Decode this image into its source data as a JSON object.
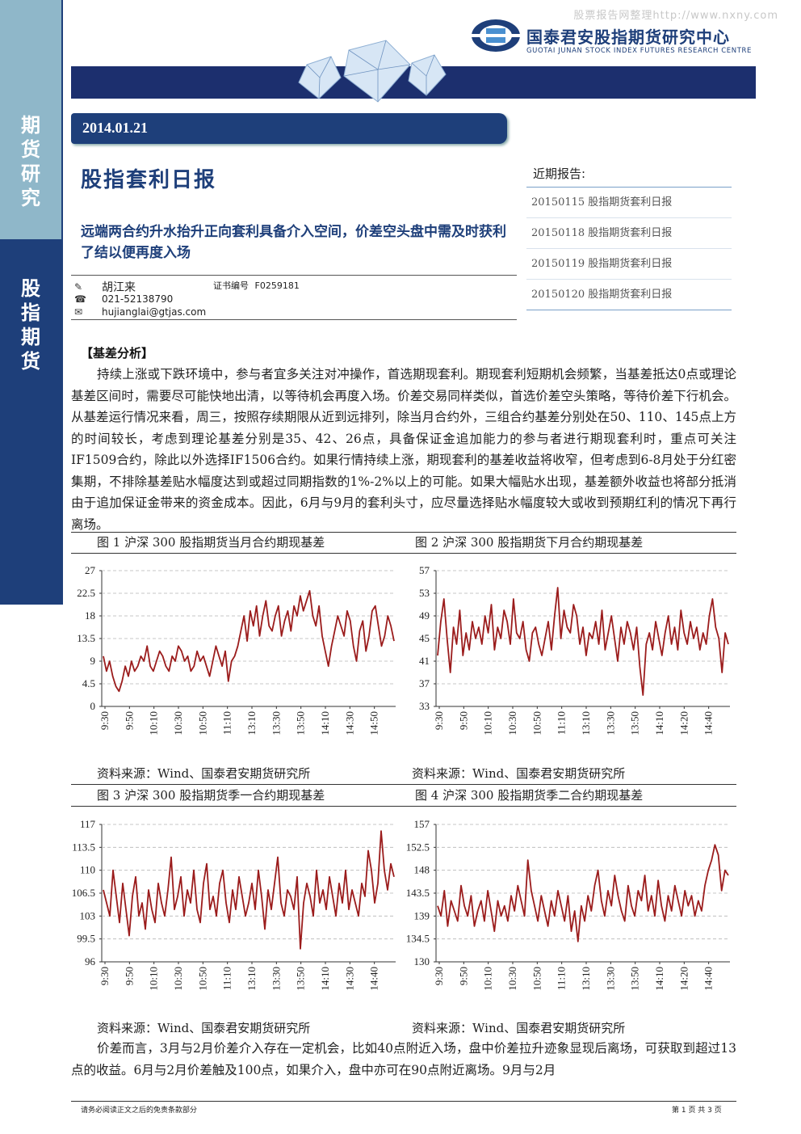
{
  "watermark": "股票报告网整理http://www.nxny.com",
  "sidebar": {
    "top_label": "期货研究",
    "bottom_label": "股指期货"
  },
  "logo": {
    "name_cn": "国泰君安股指期货研究中心",
    "name_en": "GUOTAI JUNAN STOCK INDEX FUTURES RESEARCH CENTRE"
  },
  "date": "2014.01.21",
  "title": "股指套利日报",
  "headline": "远端两合约升水抬升正向套利具备介入空间，价差空头盘中需及时获利了结以便再度入场",
  "author": {
    "name": "胡江来",
    "cert_label": "证书编号",
    "cert_no": "F0259181",
    "phone": "021-52138790",
    "email": "hujianglai@gtjas.com"
  },
  "recent": {
    "title": "近期报告:",
    "items": [
      "20150115 股指期货套利日报",
      "20150118 股指期货套利日报",
      "20150119 股指期货套利日报",
      "20150120 股指期货套利日报"
    ]
  },
  "section_title": "【基差分析】",
  "paragraph1": "持续上涨或下跌环境中，参与者宜多关注对冲操作，首选期现套利。期现套利短期机会频繁，当基差抵达0点或理论基差区间时，需要尽可能快地出清，以等待机会再度入场。价差交易同样类似，首选价差空头策略，等待价差下行机会。从基差运行情况来看，周三，按照存续期限从近到远排列，除当月合约外，三组合约基差分别处在50、110、145点上方的时间较长，考虑到理论基差分别是35、42、26点，具备保证金追加能力的参与者进行期现套利时，重点可关注IF1509合约，除此以外选择IF1506合约。如果行情持续上涨，期现套利的基差收益将收窄，但考虑到6-8月处于分红密集期，不排除基差贴水幅度达到或超过同期指数的1%-2%以上的可能。如果大幅贴水出现，基差额外收益也将部分抵消由于追加保证金带来的资金成本。因此，6月与9月的套利头寸，应尽量选择贴水幅度较大或收到预期红利的情况下再行离场。",
  "paragraph2": "价差而言，3月与2月价差介入存在一定机会，比如40点附近入场，盘中价差拉升迹象显现后离场，可获取到超过13点的收益。6月与2月价差触及100点，如果介入，盘中亦可在90点附近离场。9月与2月",
  "source_text": "资料来源：Wind、国泰君安期货研究所",
  "footer": {
    "left": "请务必阅读正文之后的免责条款部分",
    "right": "第 1 页 共 3 页"
  },
  "colors": {
    "navy": "#1e3f7a",
    "line": "#9b1c1c"
  },
  "chart_data": [
    {
      "type": "line",
      "caption": "图 1 沪深 300 股指期货当月合约期现基差",
      "x_ticks": [
        "9:30",
        "9:50",
        "10:10",
        "10:30",
        "10:50",
        "11:10",
        "13:10",
        "13:30",
        "13:50",
        "14:10",
        "14:30",
        "14:50"
      ],
      "y_ticks": [
        "27",
        "22.5",
        "18",
        "13.5",
        "9",
        "4.5",
        "0"
      ],
      "ylim": [
        0,
        27
      ],
      "values": [
        10,
        7,
        9,
        6,
        4,
        3,
        5,
        8,
        6,
        9,
        7,
        8,
        10,
        9,
        12,
        8,
        7,
        9,
        11,
        10,
        8,
        7,
        10,
        9,
        12,
        11,
        9,
        10,
        7,
        8,
        11,
        9,
        10,
        8,
        6,
        9,
        12,
        10,
        8,
        11,
        5,
        9,
        10,
        12,
        15,
        18,
        13,
        19,
        16,
        20,
        14,
        18,
        21,
        16,
        15,
        18,
        20,
        14,
        17,
        19,
        15,
        20,
        18,
        22,
        19,
        21,
        23,
        18,
        16,
        20,
        14,
        11,
        8,
        12,
        15,
        18,
        16,
        14,
        19,
        17,
        12,
        9,
        15,
        17,
        11,
        14,
        19,
        20,
        16,
        12,
        14,
        18,
        16,
        13
      ]
    },
    {
      "type": "line",
      "caption": "图 2 沪深 300 股指期货下月合约期现基差",
      "x_ticks": [
        "9:30",
        "9:50",
        "10:10",
        "10:30",
        "10:50",
        "11:10",
        "13:10",
        "13:30",
        "13:50",
        "14:10",
        "14:20",
        "14:40"
      ],
      "y_ticks": [
        "57",
        "53",
        "49",
        "45",
        "41",
        "37",
        "33"
      ],
      "ylim": [
        33,
        57
      ],
      "values": [
        42,
        48,
        52,
        45,
        39,
        47,
        44,
        50,
        42,
        46,
        43,
        48,
        45,
        47,
        44,
        49,
        46,
        51,
        43,
        47,
        45,
        50,
        48,
        44,
        52,
        46,
        45,
        48,
        43,
        41,
        46,
        47,
        44,
        42,
        45,
        48,
        43,
        49,
        54,
        45,
        50,
        47,
        46,
        51,
        49,
        44,
        47,
        42,
        46,
        45,
        48,
        44,
        50,
        43,
        46,
        49,
        45,
        41,
        47,
        44,
        48,
        46,
        43,
        47,
        40,
        35,
        44,
        46,
        43,
        48,
        45,
        42,
        46,
        49,
        44,
        47,
        43,
        50,
        46,
        44,
        48,
        45,
        47,
        43,
        46,
        44,
        49,
        52,
        47,
        45,
        39,
        46,
        44
      ]
    },
    {
      "type": "line",
      "caption": "图 3 沪深 300 股指期货季一合约期现基差",
      "x_ticks": [
        "9:30",
        "9:50",
        "10:10",
        "10:30",
        "10:50",
        "11:10",
        "13:10",
        "13:30",
        "13:50",
        "14:10",
        "14:30",
        "14:40"
      ],
      "y_ticks": [
        "117",
        "113.5",
        "110",
        "106.5",
        "103",
        "99.5",
        "96"
      ],
      "ylim": [
        96,
        117
      ],
      "values": [
        107,
        105,
        103,
        110,
        106,
        102,
        108,
        104,
        100,
        106,
        109,
        103,
        105,
        101,
        107,
        104,
        102,
        108,
        105,
        103,
        107,
        112,
        104,
        106,
        109,
        103,
        107,
        105,
        110,
        104,
        102,
        108,
        111,
        104,
        106,
        103,
        108,
        110,
        105,
        102,
        107,
        104,
        109,
        106,
        103,
        105,
        108,
        104,
        110,
        106,
        101,
        107,
        104,
        108,
        112,
        105,
        103,
        107,
        106,
        104,
        109,
        98,
        105,
        108,
        106,
        103,
        110,
        105,
        107,
        104,
        109,
        106,
        103,
        108,
        105,
        110,
        104,
        107,
        105,
        103,
        108,
        106,
        113,
        110,
        105,
        108,
        116,
        110,
        107,
        111,
        109
      ]
    },
    {
      "type": "line",
      "caption": "图 4 沪深 300 股指期货季二合约期现基差",
      "x_ticks": [
        "9:30",
        "9:50",
        "10:10",
        "10:30",
        "10:50",
        "11:10",
        "13:10",
        "13:30",
        "13:50",
        "14:10",
        "14:20",
        "14:40"
      ],
      "y_ticks": [
        "157",
        "152.5",
        "148",
        "143.5",
        "139",
        "134.5",
        "130"
      ],
      "ylim": [
        130,
        157
      ],
      "values": [
        141,
        139,
        144,
        137,
        142,
        140,
        138,
        145,
        141,
        139,
        143,
        137,
        140,
        142,
        138,
        144,
        140,
        136,
        142,
        139,
        141,
        138,
        143,
        140,
        145,
        142,
        139,
        150,
        144,
        141,
        138,
        143,
        140,
        137,
        142,
        139,
        144,
        141,
        138,
        143,
        136,
        140,
        134,
        141,
        138,
        143,
        140,
        145,
        148,
        142,
        139,
        144,
        141,
        147,
        143,
        140,
        138,
        145,
        141,
        139,
        144,
        142,
        147,
        140,
        143,
        139,
        146,
        141,
        138,
        143,
        140,
        145,
        142,
        139,
        144,
        141,
        143,
        139,
        142,
        140,
        145,
        148,
        150,
        153,
        151,
        144,
        148,
        147
      ]
    }
  ]
}
